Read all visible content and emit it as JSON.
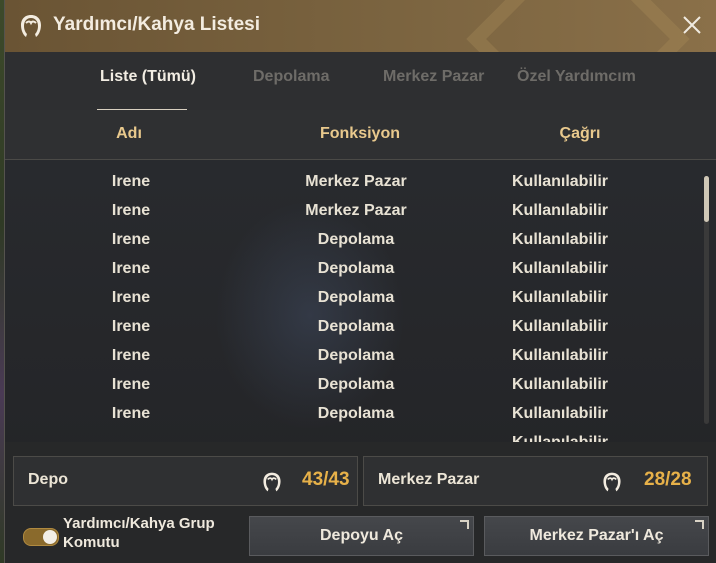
{
  "window": {
    "title": "Yardımcı/Kahya Listesi",
    "title_icon": "helper-head-icon",
    "close_icon": "close-icon"
  },
  "tabs": [
    {
      "label": "Liste (Tümü)",
      "active": true
    },
    {
      "label": "Depolama",
      "active": false
    },
    {
      "label": "Merkez Pazar",
      "active": false
    },
    {
      "label": "Özel Yardımcım",
      "active": false
    }
  ],
  "table": {
    "headers": [
      "Adı",
      "Fonksiyon",
      "Çağrı"
    ],
    "rows": [
      [
        "Irene",
        "Merkez Pazar",
        "Kullanılabilir"
      ],
      [
        "Irene",
        "Merkez Pazar",
        "Kullanılabilir"
      ],
      [
        "Irene",
        "Depolama",
        "Kullanılabilir"
      ],
      [
        "Irene",
        "Depolama",
        "Kullanılabilir"
      ],
      [
        "Irene",
        "Depolama",
        "Kullanılabilir"
      ],
      [
        "Irene",
        "Depolama",
        "Kullanılabilir"
      ],
      [
        "Irene",
        "Depolama",
        "Kullanılabilir"
      ],
      [
        "Irene",
        "Depolama",
        "Kullanılabilir"
      ],
      [
        "Irene",
        "Depolama",
        "Kullanılabilir"
      ],
      [
        "",
        "",
        "Kullanılabilir"
      ]
    ]
  },
  "counters": {
    "depo": {
      "label": "Depo",
      "value": "43/43",
      "icon": "helper-head-icon"
    },
    "merkez": {
      "label": "Merkez Pazar",
      "value": "28/28",
      "icon": "helper-head-icon"
    }
  },
  "group_command": {
    "label": "Yardımcı/Kahya Grup Komutu",
    "enabled": true
  },
  "buttons": {
    "open_storage": "Depoyu Aç",
    "open_market": "Merkez Pazar'ı Aç"
  },
  "colors": {
    "accent": "#e7b149",
    "header_text": "#e9c98d",
    "titlebar": "#7b6440"
  }
}
